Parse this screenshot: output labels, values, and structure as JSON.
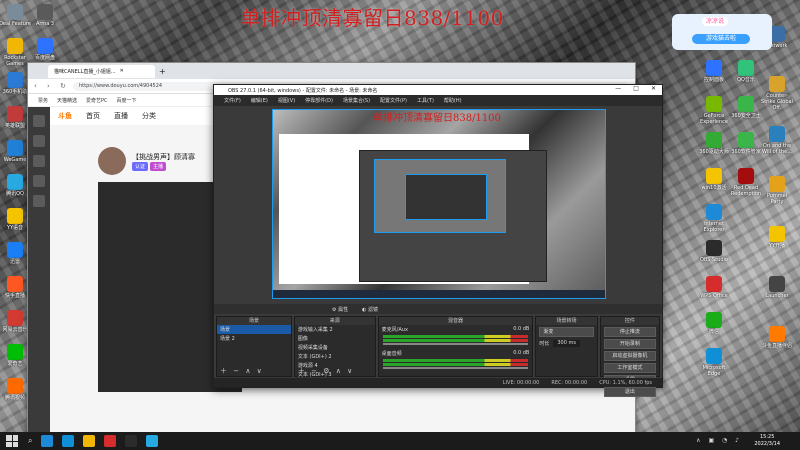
{
  "overlay_title": "单排冲顶清寡留日838/1100",
  "preview_overlay": "单排冲顶清寡留日838/1100",
  "desktop_icons_left": [
    {
      "label": "Deal Feature",
      "color": "#7a8c99"
    },
    {
      "label": "Rockstar Games",
      "color": "#f2b705"
    },
    {
      "label": "360手机助",
      "color": "#2b7bd6"
    },
    {
      "label": "英雄联盟",
      "color": "#c23b3b"
    },
    {
      "label": "WeGame",
      "color": "#1f80d6"
    },
    {
      "label": "腾讯QQ",
      "color": "#27a9e1"
    },
    {
      "label": "YY语音",
      "color": "#f5c400"
    },
    {
      "label": "迅雷",
      "color": "#1a7ff5"
    },
    {
      "label": "快手直播",
      "color": "#ff5722"
    },
    {
      "label": "网易云音乐",
      "color": "#d33a31"
    },
    {
      "label": "爱奇艺",
      "color": "#00be06"
    },
    {
      "label": "腾讯视频",
      "color": "#ff6a00"
    },
    {
      "label": "Arma 3",
      "color": "#5a5a5a"
    },
    {
      "label": "百度网盘",
      "color": "#2e73ff"
    },
    {
      "label": "腾讯游戏",
      "color": "#c23b3b"
    },
    {
      "label": "直播伴侣",
      "color": "#fe2c55"
    }
  ],
  "desktop_icons_right": [
    {
      "label": "控制面板",
      "color": "#2e73ff"
    },
    {
      "label": "GeForce Experience",
      "color": "#76b900"
    },
    {
      "label": "360驱动大师",
      "color": "#33aa33"
    },
    {
      "label": "win10激活",
      "color": "#f5c400"
    },
    {
      "label": "Internet Explorer",
      "color": "#1c8ad6"
    },
    {
      "label": "OBS Studio",
      "color": "#2b2b2b"
    },
    {
      "label": "WPS Office",
      "color": "#d62c2c"
    },
    {
      "label": "微信",
      "color": "#1aad19"
    },
    {
      "label": "Microsoft Edge",
      "color": "#0f8fd6"
    },
    {
      "label": "QQ音乐",
      "color": "#31c27c"
    },
    {
      "label": "360安全卫士",
      "color": "#3ab54a"
    },
    {
      "label": "360软件管家",
      "color": "#3ab54a"
    },
    {
      "label": "Red Dead Redemption",
      "color": "#a30d0d"
    }
  ],
  "desktop_icons_far_right": [
    {
      "label": "Network",
      "color": "#3a6ea5"
    },
    {
      "label": "Counter-Strike Global Off.",
      "color": "#d8a32a"
    },
    {
      "label": "Ori and the Will of the...",
      "color": "#2a7fbd"
    },
    {
      "label": "Pummel Party",
      "color": "#e3a21a"
    },
    {
      "label": "YY开播",
      "color": "#f5c400"
    },
    {
      "label": "Launcher",
      "color": "#444"
    },
    {
      "label": "斗鱼直播伴侣",
      "color": "#ff7a00"
    }
  ],
  "browser": {
    "tab_title": "猫咪CANELL直播_小姐姐...",
    "url": "https://www.douyu.com/4904524",
    "bookmarks": [
      "票务",
      "天猫精选",
      "爱奇艺PC",
      "百度一下"
    ],
    "site_nav": [
      "首页",
      "直播",
      "分类"
    ],
    "logo": "斗鱼",
    "streamer_name": "【挑战男声】顾清寡",
    "streamer_badges": [
      "认证",
      "主播"
    ]
  },
  "obs": {
    "title": "OBS 27.0.1 (64-bit, windows) - 配置文件: 未命名 - 场景: 未命名",
    "menu": [
      "文件(F)",
      "编辑(E)",
      "视图(V)",
      "停靠部件(D)",
      "场景集合(S)",
      "配置文件(P)",
      "工具(T)",
      "帮助(H)"
    ],
    "source_toolbar": [
      "属性",
      "滤镜"
    ],
    "docks": {
      "scenes": {
        "title": "场景",
        "items": [
          "场景",
          "场景 2"
        ]
      },
      "sources": {
        "title": "来源",
        "items": [
          "游戏输入采集 2",
          "图像",
          "视频采集设备",
          "文本 (GDI+) 2",
          "游戏源 4",
          "文本 (GDI+) 3"
        ]
      },
      "mixer": {
        "title": "混音器",
        "items": [
          {
            "name": "麦克风/Aux",
            "level": "0.0 dB"
          },
          {
            "name": "桌面音频",
            "level": "0.0 dB"
          }
        ]
      },
      "transitions": {
        "title": "场景转场",
        "type": "渐变",
        "duration_label": "时长",
        "duration": "300 ms"
      },
      "controls": {
        "title": "控件",
        "buttons": [
          "停止推流",
          "开始录制",
          "启动虚拟摄像机",
          "工作室模式",
          "设置",
          "退出"
        ]
      }
    },
    "status": {
      "live": "LIVE: 00:00:00",
      "rec": "REC: 00:00:00",
      "cpu": "CPU: 1.1%, 60.00 fps"
    }
  },
  "taskbar": {
    "time": "15:25",
    "date": "2022/3/14",
    "icons_colors": [
      "#1c8ad6",
      "#0f8fd6",
      "#f2b705",
      "#d62c2c",
      "#2b2b2b",
      "#27a9e1"
    ]
  },
  "cat_widget": {
    "top": "凉凉说",
    "bottom": "游戏猫去啦"
  }
}
